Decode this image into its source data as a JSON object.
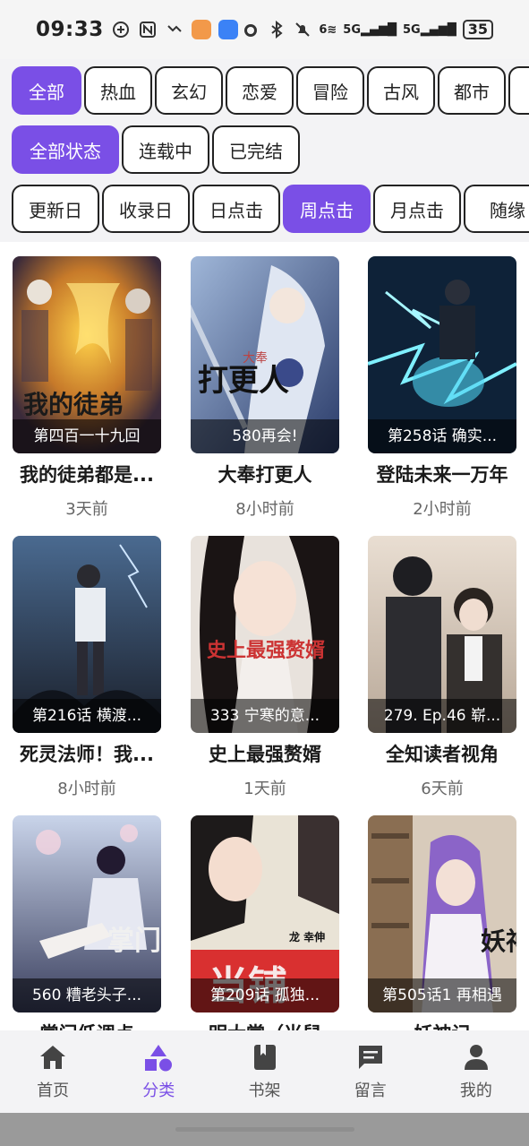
{
  "status_bar": {
    "time": "09:33",
    "battery": "35",
    "signal_1": "5G",
    "signal_2": "5G",
    "wifi_label": "6"
  },
  "filters": {
    "genres": [
      "全部",
      "热血",
      "玄幻",
      "恋爱",
      "冒险",
      "古风",
      "都市"
    ],
    "statuses": [
      "全部状态",
      "连载中",
      "已完结"
    ],
    "sorts": [
      "更新日",
      "收录日",
      "日点击",
      "周点击",
      "月点击",
      "随缘"
    ],
    "active_genre": "全部",
    "active_status": "全部状态",
    "active_sort": "周点击"
  },
  "comics": [
    {
      "title": "我的徒弟都是...",
      "chapter": "第四百一十九回",
      "time": "3天前"
    },
    {
      "title": "大奉打更人",
      "chapter": "580再会!",
      "time": "8小时前"
    },
    {
      "title": "登陆未来一万年",
      "chapter": "第258话 确实...",
      "time": "2小时前"
    },
    {
      "title": "死灵法师！我...",
      "chapter": "第216话 横渡...",
      "time": "8小时前"
    },
    {
      "title": "史上最强赘婿",
      "chapter": "333 宁寒的意...",
      "time": "1天前"
    },
    {
      "title": "全知读者视角",
      "chapter": "279. Ep.46 崭...",
      "time": "6天前"
    },
    {
      "title": "掌门低调点",
      "chapter": "560 糟老头子...",
      "time": ""
    },
    {
      "title": "明大掌（当鼠",
      "chapter": "第209话 孤独...",
      "time": ""
    },
    {
      "title": "妖神记",
      "chapter": "第505话1 再相遇",
      "time": ""
    }
  ],
  "cover_text": {
    "c1": "我的徒弟",
    "c2a": "大奉",
    "c2b": "打更人",
    "c5": "史上最强赘婿",
    "c7": "掌门",
    "c8a": "当铺",
    "c8b": "龙 幸伸",
    "c9": "妖神"
  },
  "nav": [
    {
      "label": "首页",
      "icon": "home-icon"
    },
    {
      "label": "分类",
      "icon": "category-icon"
    },
    {
      "label": "书架",
      "icon": "bookshelf-icon"
    },
    {
      "label": "留言",
      "icon": "message-icon"
    },
    {
      "label": "我的",
      "icon": "profile-icon"
    }
  ],
  "colors": {
    "accent": "#7a4fe6",
    "chip_border": "#222222",
    "nav_bg": "#f3f3f5"
  }
}
